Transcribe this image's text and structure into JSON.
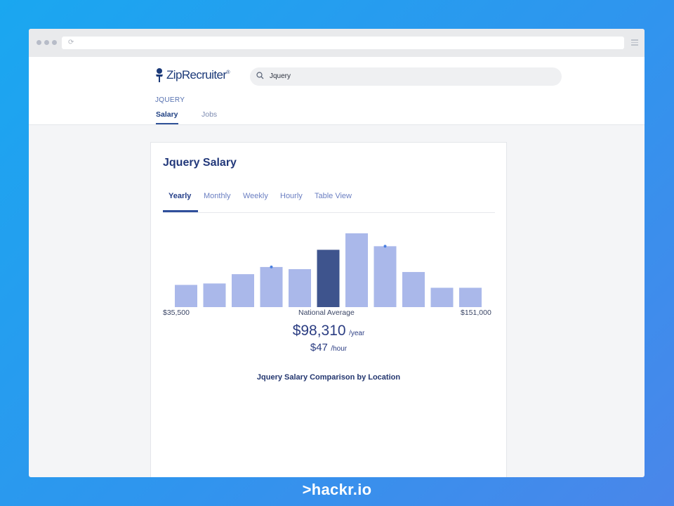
{
  "browser": {
    "url": ""
  },
  "site": {
    "logo_text": "ZipRecruiter",
    "logo_mark": "®",
    "search_value": "Jquery",
    "breadcrumb": "JQUERY",
    "nav_tabs": [
      {
        "label": "Salary",
        "active": true
      },
      {
        "label": "Jobs",
        "active": false
      }
    ]
  },
  "card": {
    "title": "Jquery Salary",
    "tabs": [
      {
        "label": "Yearly",
        "active": true
      },
      {
        "label": "Monthly",
        "active": false
      },
      {
        "label": "Weekly",
        "active": false
      },
      {
        "label": "Hourly",
        "active": false
      },
      {
        "label": "Table View",
        "active": false
      }
    ],
    "range_min": "$35,500",
    "range_label": "National Average",
    "range_max": "$151,000",
    "yearly_amount": "$98,310",
    "yearly_unit": "/year",
    "hourly_amount": "$47",
    "hourly_unit": "/hour",
    "comparison_heading": "Jquery Salary Comparison by Location"
  },
  "chart_data": {
    "type": "bar",
    "xlim": [
      "$35,500",
      "$151,000"
    ],
    "values": [
      31,
      33,
      46,
      56,
      53,
      80,
      103,
      85,
      49,
      27,
      27
    ],
    "highlighted_index": 5,
    "markers": [
      3,
      7
    ],
    "colors": {
      "bar": "#aab8ea",
      "highlight": "#3e548d",
      "marker": "#4a7fe0"
    }
  },
  "brand": {
    "text": ">hackr.io"
  },
  "colors": {
    "accent": "#2f5298",
    "background_start": "#1aa7f0",
    "background_end": "#4a86ea"
  }
}
